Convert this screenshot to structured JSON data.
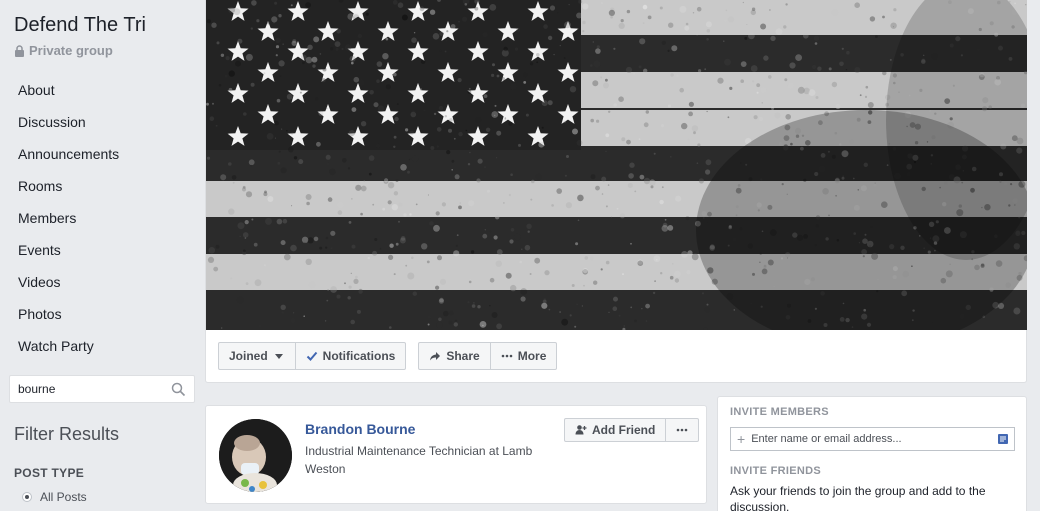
{
  "group": {
    "title": "Defend The Tri",
    "privacy": "Private group"
  },
  "sidebar": {
    "items": [
      {
        "label": "About"
      },
      {
        "label": "Discussion"
      },
      {
        "label": "Announcements"
      },
      {
        "label": "Rooms"
      },
      {
        "label": "Members"
      },
      {
        "label": "Events"
      },
      {
        "label": "Videos"
      },
      {
        "label": "Photos"
      },
      {
        "label": "Watch Party"
      }
    ],
    "search_value": "bourne",
    "filter_title": "Filter Results",
    "post_type_heading": "POST TYPE",
    "post_type_option": "All Posts"
  },
  "cover": {
    "image": "black-and-white-american-flag"
  },
  "actions": {
    "joined_label": "Joined",
    "notifications_label": "Notifications",
    "share_label": "Share",
    "more_label": "More"
  },
  "member": {
    "name": "Brandon Bourne",
    "description": "Industrial Maintenance Technician at Lamb Weston",
    "add_friend_label": "Add Friend"
  },
  "invite": {
    "members_heading": "INVITE MEMBERS",
    "input_placeholder": "Enter name or email address...",
    "friends_heading": "INVITE FRIENDS",
    "friends_text": "Ask your friends to join the group and add to the discussion."
  },
  "colors": {
    "link": "#365899",
    "background": "#e9ebee",
    "check": "#4267b2"
  }
}
